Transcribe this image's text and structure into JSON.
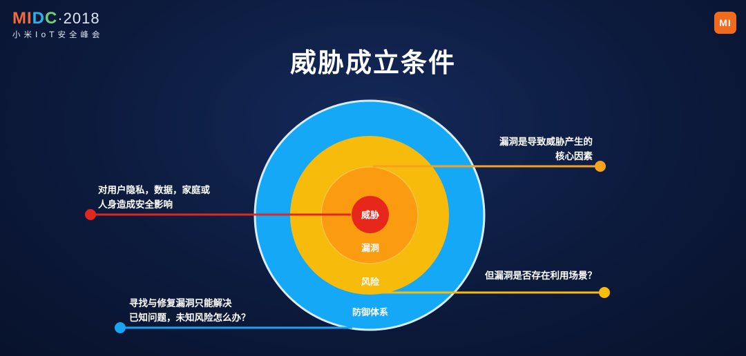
{
  "brand": {
    "name_m": "MI",
    "name_d": "D",
    "name_c": "C",
    "year": "·2018",
    "subtitle": "小米IoT安全峰会"
  },
  "logo": {
    "text": "MI"
  },
  "title": "威胁成立条件",
  "rings": {
    "core": "威胁",
    "vulnerability": "漏洞",
    "risk": "风险",
    "defense": "防御体系"
  },
  "notes": {
    "vulnerability": [
      "漏洞是导致威胁产生的",
      "核心因素"
    ],
    "threat": [
      "对用户隐私，数据，家庭或",
      "人身造成安全影响"
    ],
    "risk": "但漏洞是否存在利用场景？",
    "defense": [
      "寻找与修复漏洞只能解决",
      "已知问题，未知风险怎么办？"
    ]
  },
  "colors": {
    "defense": "#14a8f7",
    "risk": "#f7bb0c",
    "vulnerability": "#fb9b0f",
    "core": "#e8271c",
    "risk_dot": "#f7bb0c",
    "vuln_dot": "#f7a21e",
    "threat_dot": "#e0281f",
    "defense_dot": "#1aa3f3"
  }
}
